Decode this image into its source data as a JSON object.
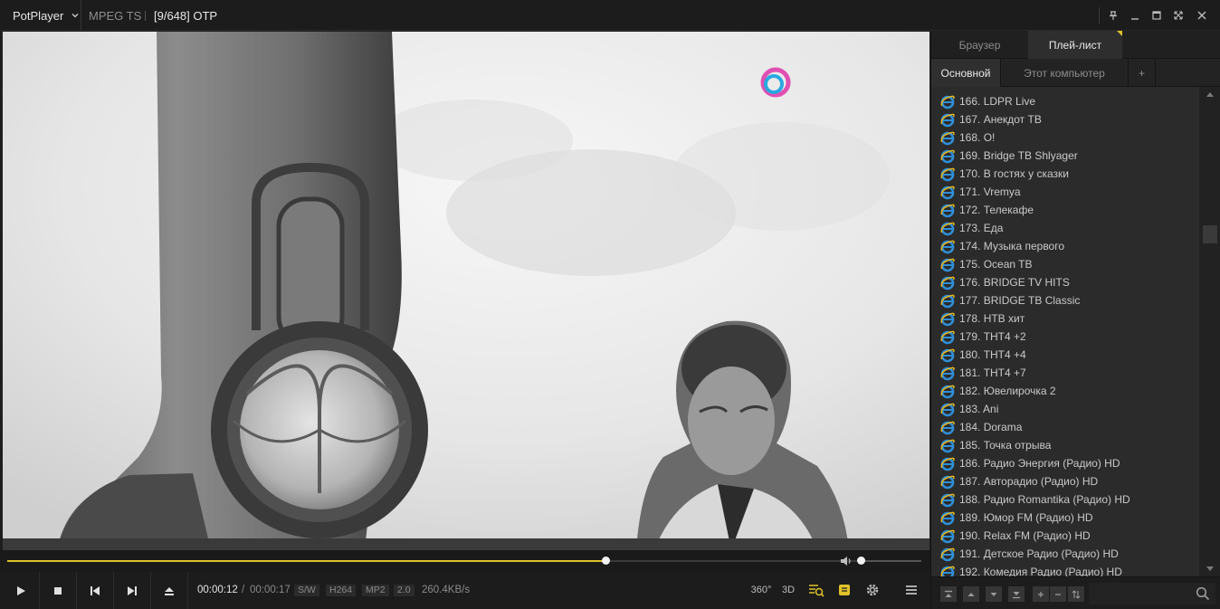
{
  "titlebar": {
    "app_name": "PotPlayer",
    "format": "MPEG TS",
    "title": "[9/648] ОТР",
    "buttons": [
      "pin-icon",
      "minimize-icon",
      "maximize-icon",
      "fullscreen-icon",
      "close-icon"
    ]
  },
  "playback": {
    "current_time": "00:00:12",
    "separator": "/",
    "total_time": "00:00:17",
    "progress": 0.655,
    "volume": 0.05,
    "badges": [
      "S/W",
      "H264",
      "MP2",
      "2.0"
    ],
    "bitrate": "260.4KB/s",
    "left_buttons": [
      "play-icon",
      "stop-icon",
      "previous-icon",
      "next-icon",
      "eject-icon"
    ],
    "right_buttons": {
      "vr_label": "360°",
      "three_d_label": "3D",
      "icons": [
        "playlist-search-icon",
        "subtitles-icon",
        "settings-gear-icon",
        "menu-icon"
      ]
    },
    "colors": {
      "accent": "#e0c22a"
    }
  },
  "panel": {
    "tabs": [
      {
        "label": "Браузер",
        "active": false
      },
      {
        "label": "Плей-лист",
        "active": true
      }
    ],
    "subtabs": [
      {
        "label": "Основной",
        "active": true
      },
      {
        "label": "Этот компьютер",
        "active": false
      },
      {
        "label": "+",
        "active": false
      }
    ],
    "playlist": [
      "166. LDPR Live",
      "167. Анекдот ТВ",
      "168. О!",
      "169. Bridge ТВ Shlyager",
      "170. В гостях у сказки",
      "171. Vremya",
      "172. Телекафе",
      "173. Еда",
      "174. Музыка первого",
      "175. Ocean TB",
      "176. BRIDGE TV HITS",
      "177. BRIDGE ТВ Classic",
      "178. НТВ хит",
      "179. ТНТ4 +2",
      "180. ТНТ4 +4",
      "181. ТНТ4 +7",
      "182. Ювелирочка 2",
      "183. Ani",
      "184. Dorama",
      "185. Точка отрыва",
      "186. Радио Энергия (Радио) HD",
      "187. Авторадио (Радио) HD",
      "188. Радио Romantika (Радио) HD",
      "189. Юмор FM (Радио) HD",
      "190. Relax FM (Радио) HD",
      "191. Детское Радио (Радио) HD",
      "192. Комедия Радио (Радио) HD"
    ],
    "scroll_position": 0.28,
    "bottom_buttons": [
      "move-top-icon",
      "move-up-icon",
      "move-down-icon",
      "move-bottom-icon",
      "add-icon",
      "remove-icon",
      "sort-icon"
    ],
    "search_icon": "search-icon"
  }
}
